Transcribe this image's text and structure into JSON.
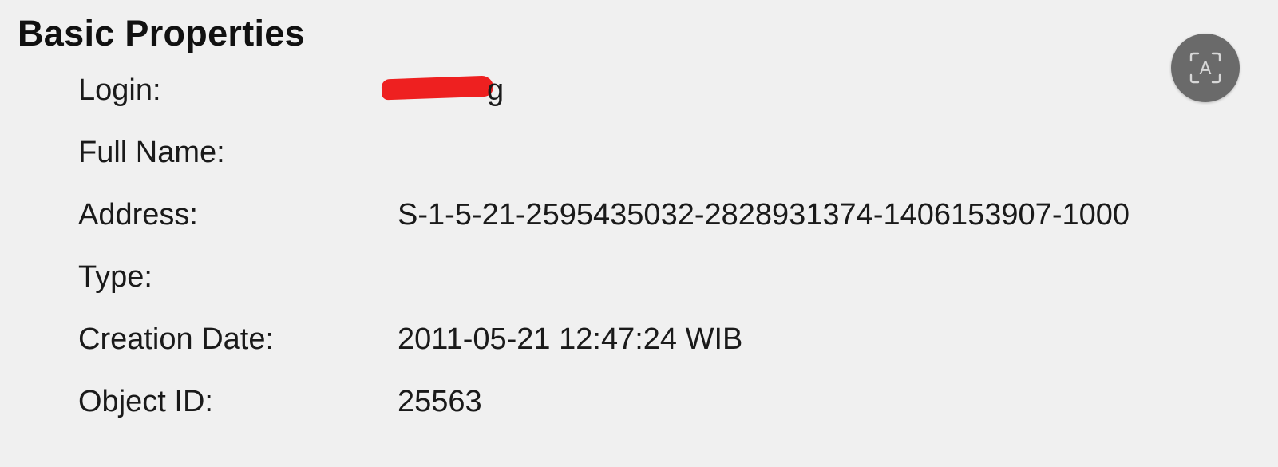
{
  "section": {
    "title": "Basic Properties"
  },
  "properties": [
    {
      "label": "Login:",
      "value": "",
      "redacted": true,
      "visible_tail": "g"
    },
    {
      "label": "Full Name:",
      "value": ""
    },
    {
      "label": "Address:",
      "value": "S-1-5-21-2595435032-2828931374-1406153907-1000"
    },
    {
      "label": "Type:",
      "value": ""
    },
    {
      "label": "Creation Date:",
      "value": "2011-05-21 12:47:24 WIB"
    },
    {
      "label": "Object ID:",
      "value": "25563"
    }
  ],
  "ocr_button": {
    "icon": "text-select-icon",
    "glyph": "A"
  },
  "colors": {
    "background": "#f0f0f0",
    "redaction": "#ee2020",
    "ocr_button": "#6a6a6a"
  }
}
